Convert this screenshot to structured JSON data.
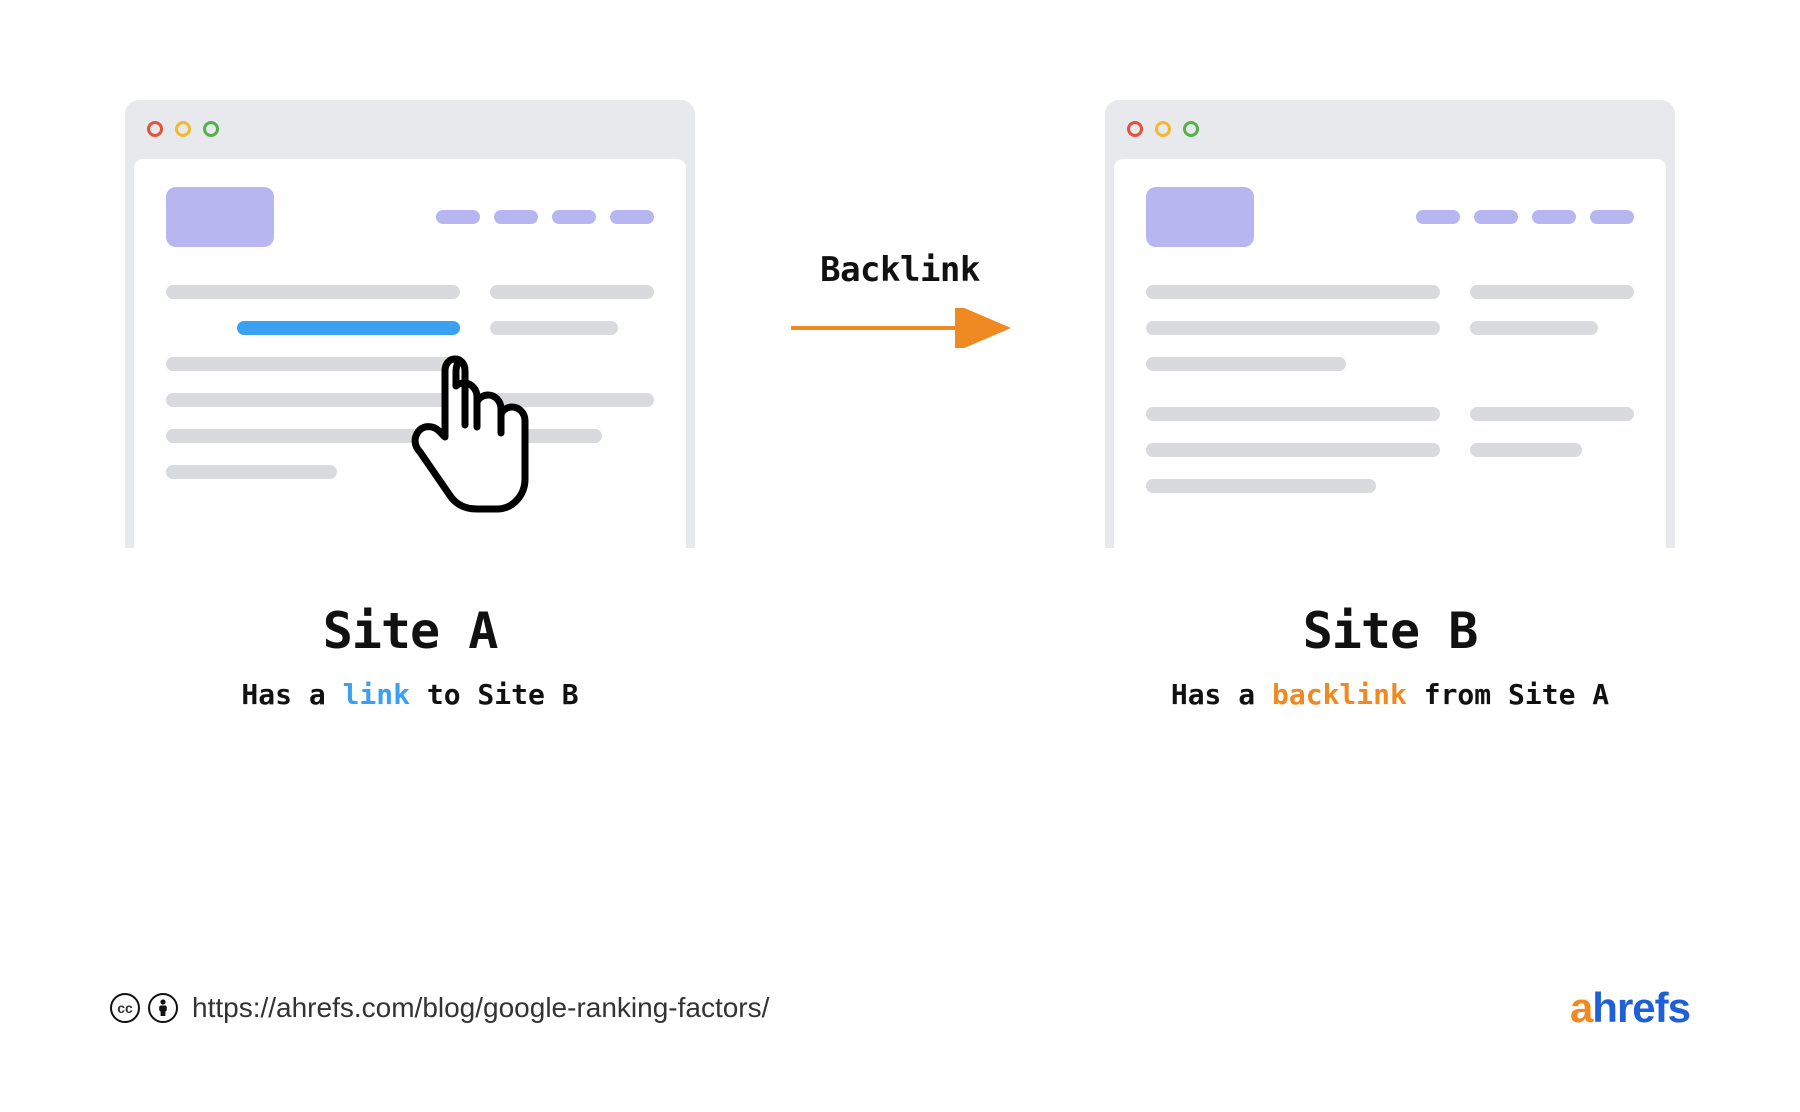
{
  "arrow": {
    "label": "Backlink",
    "color": "#ef8a22"
  },
  "siteA": {
    "title": "Site A",
    "sub_prefix": "Has a ",
    "sub_highlight": "link",
    "sub_suffix": " to Site B",
    "highlight_class": "hl-blue"
  },
  "siteB": {
    "title": "Site B",
    "sub_prefix": "Has a ",
    "sub_highlight": "backlink",
    "sub_suffix": " from Site A",
    "highlight_class": "hl-orange"
  },
  "footer": {
    "url": "https://ahrefs.com/blog/google-ranking-factors/",
    "brand_first": "a",
    "brand_rest": "hrefs"
  },
  "colors": {
    "link_blue": "#3aa0f2",
    "accent_orange": "#ef8a22",
    "placeholder_purple": "#b7b6f0",
    "placeholder_gray": "#d9dadd"
  }
}
